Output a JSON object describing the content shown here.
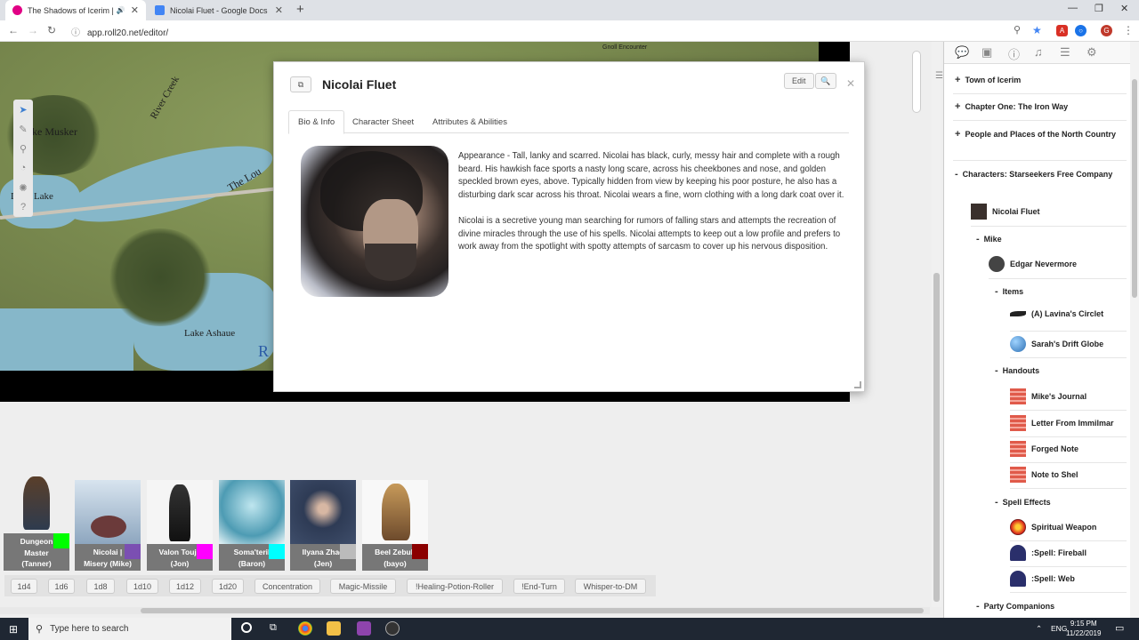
{
  "browser": {
    "tabs": [
      {
        "title": "The Shadows of Icerim | Roll20",
        "active": true
      },
      {
        "title": "Nicolai Fluet - Google Docs",
        "active": false
      }
    ],
    "url": "app.roll20.net/editor/",
    "profile_initial": "G"
  },
  "map": {
    "labels": {
      "lake_musker": "ke Musker",
      "river_creek": "River Creek",
      "duca_lake": "Duca Lake",
      "the_lou": "The Lou",
      "lake_ashaue": "Lake Ashaue",
      "gnoll_encounter": "Gnoll Encounter",
      "partial_r": "R"
    }
  },
  "dialog": {
    "title": "Nicolai Fluet",
    "edit_label": "Edit",
    "tabs": [
      "Bio & Info",
      "Character Sheet",
      "Attributes & Abilities"
    ],
    "active_tab": "Bio & Info",
    "bio_paragraph_1": "Appearance - Tall, lanky and scarred. Nicolai has black, curly, messy hair and complete with a rough beard. His hawkish face sports a nasty long scare, across his cheekbones and nose, and golden speckled brown eyes, above. Typically hidden from view by keeping his poor posture, he also has a disturbing dark scar across his throat.  Nicolai wears a fine, worn clothing with a long dark coat over it.",
    "bio_paragraph_2": "Nicolai is a secretive young man searching for rumors of falling stars and attempts the recreation of divine miracles through the use of his spells. Nicolai attempts to keep out a low profile and prefers to work away from the spotlight with spotty attempts of sarcasm to cover up his nervous disposition."
  },
  "players": [
    {
      "name_line1": "Dungeon",
      "name_line2": "Master",
      "name_line3": "(Tanner)",
      "color": "#00ff00"
    },
    {
      "name_line1": "Nicolai |",
      "name_line2": "Misery (Mike)",
      "name_line3": "",
      "color": "#7b4fb2"
    },
    {
      "name_line1": "Valon Touja",
      "name_line2": "(Jon)",
      "name_line3": "",
      "color": "#ff00ff"
    },
    {
      "name_line1": "Soma'teril",
      "name_line2": "(Baron)",
      "name_line3": "",
      "color": "#00ffff"
    },
    {
      "name_line1": "Ilyana Zhao",
      "name_line2": "(Jen)",
      "name_line3": "",
      "color": "#bbbbbb"
    },
    {
      "name_line1": "Beel Zebub",
      "name_line2": "(bayo)",
      "name_line3": "",
      "color": "#8b0000"
    }
  ],
  "macros": [
    "1d4",
    "1d6",
    "1d8",
    "1d10",
    "1d12",
    "1d20",
    "Concentration",
    "Magic-Missile",
    "!Healing-Potion-Roller",
    "!End-Turn",
    "Whisper-to-DM"
  ],
  "journal": {
    "folders_top": [
      "Town of Icerim",
      "Chapter One: The Iron Way",
      "People and Places of the North Country"
    ],
    "characters_folder": "Characters: Starseekers Free Company",
    "nicolai": "Nicolai Fluet",
    "mike_folder": "Mike",
    "edgar": "Edgar Nevermore",
    "items_folder": "Items",
    "items": [
      "(A) Lavina's Circlet",
      "Sarah's Drift Globe"
    ],
    "handouts_folder": "Handouts",
    "handouts": [
      "Mike's Journal",
      "Letter From Immilmar",
      "Forged Note",
      "Note to Shel"
    ],
    "spell_folder": "Spell Effects",
    "spells": [
      "Spiritual Weapon",
      ":Spell: Fireball",
      ":Spell: Web"
    ],
    "party_folder": "Party Companions"
  },
  "taskbar": {
    "search_placeholder": "Type here to search",
    "language": "ENG",
    "time": "9:15 PM",
    "date": "11/22/2019"
  }
}
